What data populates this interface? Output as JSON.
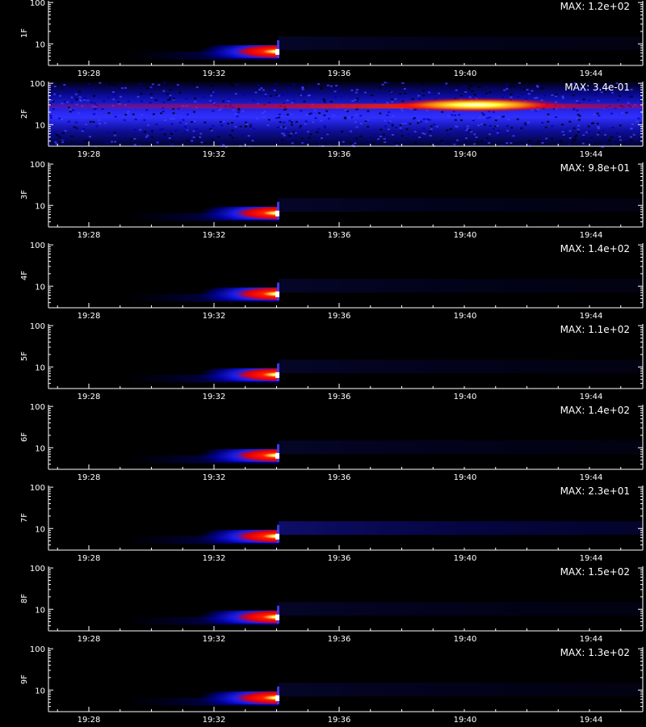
{
  "chart_data": {
    "type": "heatmap",
    "x_tick_labels": [
      "19:28",
      "19:32",
      "19:36",
      "19:40",
      "19:44"
    ],
    "y_tick_labels": [
      "10",
      "100"
    ],
    "y_scale": "log",
    "panels": [
      {
        "channel": "1F",
        "max_text": "MAX: 1.2e+02",
        "max_value": 120
      },
      {
        "channel": "2F",
        "max_text": "MAX: 3.4e-01",
        "max_value": 0.34
      },
      {
        "channel": "3F",
        "max_text": "MAX: 9.8e+01",
        "max_value": 98
      },
      {
        "channel": "4F",
        "max_text": "MAX: 1.4e+02",
        "max_value": 140
      },
      {
        "channel": "5F",
        "max_text": "MAX: 1.1e+02",
        "max_value": 110
      },
      {
        "channel": "6F",
        "max_text": "MAX: 1.4e+02",
        "max_value": 140
      },
      {
        "channel": "7F",
        "max_text": "MAX: 2.3e+01",
        "max_value": 23
      },
      {
        "channel": "8F",
        "max_text": "MAX: 1.5e+02",
        "max_value": 150
      },
      {
        "channel": "9F",
        "max_text": "MAX: 1.3e+02",
        "max_value": 130
      }
    ],
    "colormap": [
      "#000000",
      "#0000ff",
      "#ff0000",
      "#ffff00",
      "#ffffff"
    ]
  }
}
